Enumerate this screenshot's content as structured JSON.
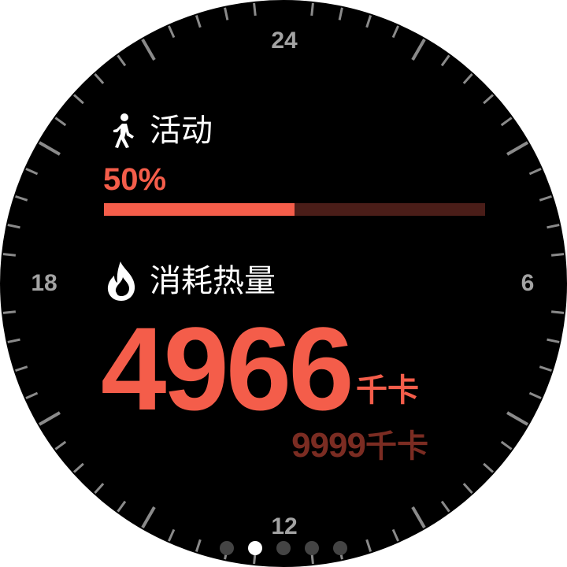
{
  "dial": {
    "hour_labels": {
      "top": "24",
      "right": "6",
      "bottom": "12",
      "left": "18"
    }
  },
  "activity": {
    "label": "活动",
    "icon": "walking-person-icon",
    "percent_text": "50%",
    "progress": 0.5
  },
  "calories": {
    "label": "消耗热量",
    "icon": "flame-icon",
    "value": "4966",
    "unit": "千卡",
    "goal_value": "9999",
    "goal_unit": "千卡"
  },
  "pager": {
    "count": 5,
    "active_index": 1
  },
  "colors": {
    "accent": "#f45d4a",
    "accent_dim": "#4a1d18",
    "goal_text": "#7b2c22",
    "tick": "#8a8a8a",
    "background": "#000000"
  }
}
